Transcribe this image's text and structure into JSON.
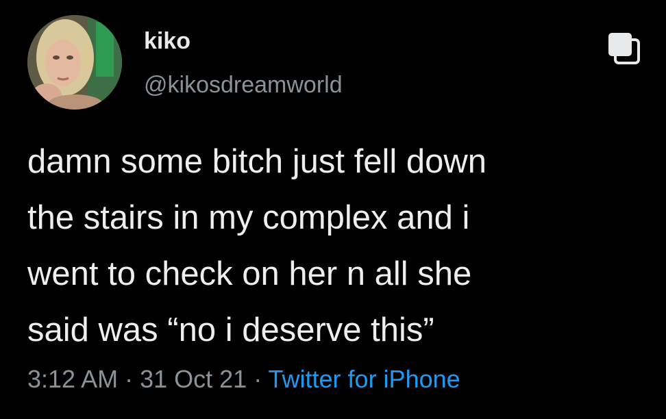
{
  "user": {
    "display_name": "kiko",
    "handle": "@kikosdreamworld"
  },
  "tweet": {
    "lines": [
      "damn some bitch just fell down",
      "the stairs in my complex and i",
      "went to check on her n all she",
      "said was “no i deserve this”"
    ]
  },
  "meta": {
    "time": "3:12 AM",
    "separator": " · ",
    "date": "31 Oct 21",
    "source": "Twitter for iPhone"
  },
  "icons": {
    "copy": "copy-icon",
    "avatar": "avatar"
  },
  "colors": {
    "background": "#000000",
    "text": "#e7e9ea",
    "muted": "#8b9298",
    "link": "#1d9bf0"
  }
}
